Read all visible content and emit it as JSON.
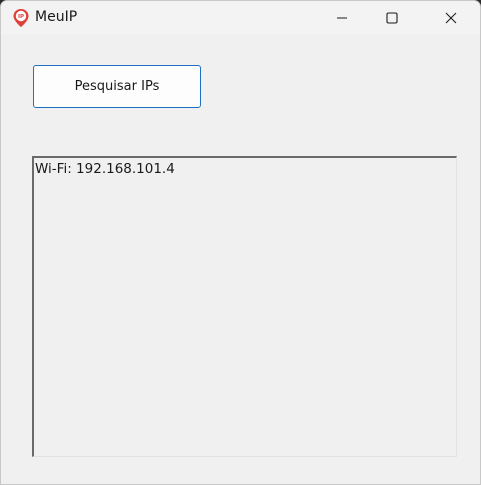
{
  "window": {
    "title": "MeuIP",
    "app_icon": "location-pin-ip-icon",
    "controls": {
      "minimize_icon": "minimize-icon",
      "maximize_icon": "maximize-icon",
      "close_icon": "close-icon"
    }
  },
  "main": {
    "search_button_label": "Pesquisar IPs",
    "output_text": "Wi-Fi: 192.168.101.4"
  },
  "colors": {
    "button_border": "#1f6fc4",
    "icon_red": "#e0403a",
    "window_bg": "#f0f0f0"
  }
}
